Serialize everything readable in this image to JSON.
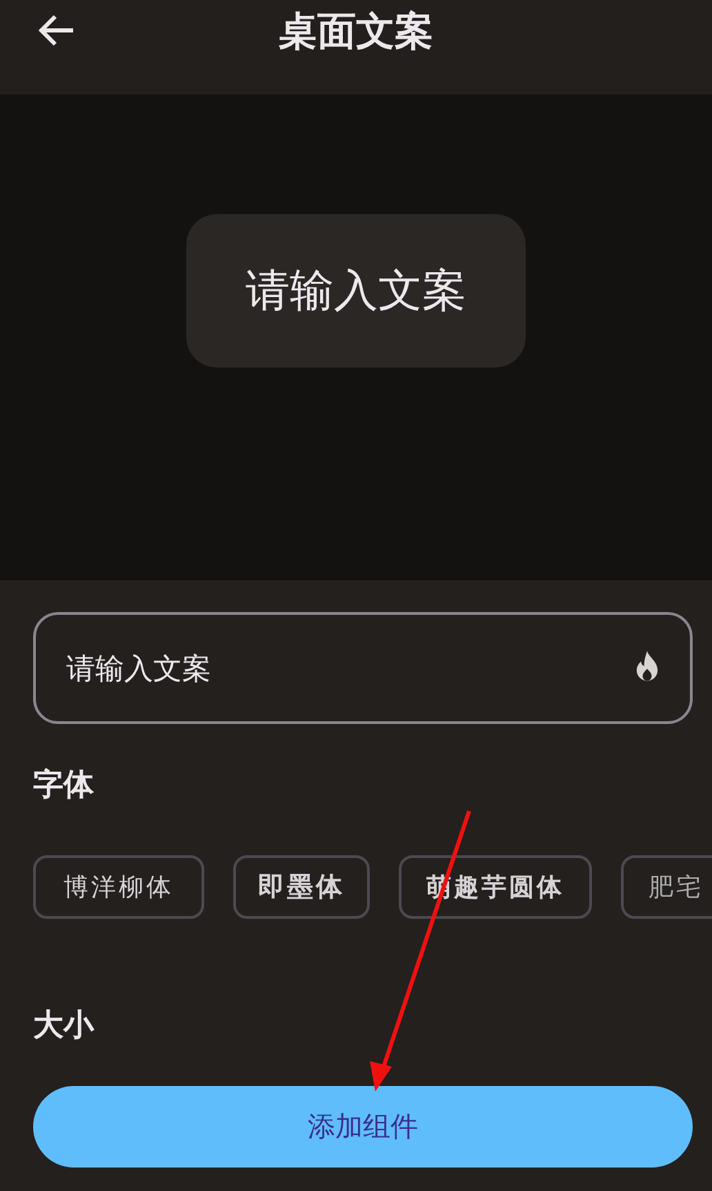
{
  "header": {
    "title": "桌面文案"
  },
  "preview": {
    "text": "请输入文案"
  },
  "input": {
    "placeholder": "请输入文案"
  },
  "font_section": {
    "title": "字体",
    "fonts": [
      {
        "label": "博洋柳体"
      },
      {
        "label": "即墨体"
      },
      {
        "label": "萌趣芋圆体"
      },
      {
        "label": "肥宅"
      }
    ]
  },
  "size_section": {
    "title": "大小"
  },
  "add_button": {
    "label": "添加组件"
  }
}
